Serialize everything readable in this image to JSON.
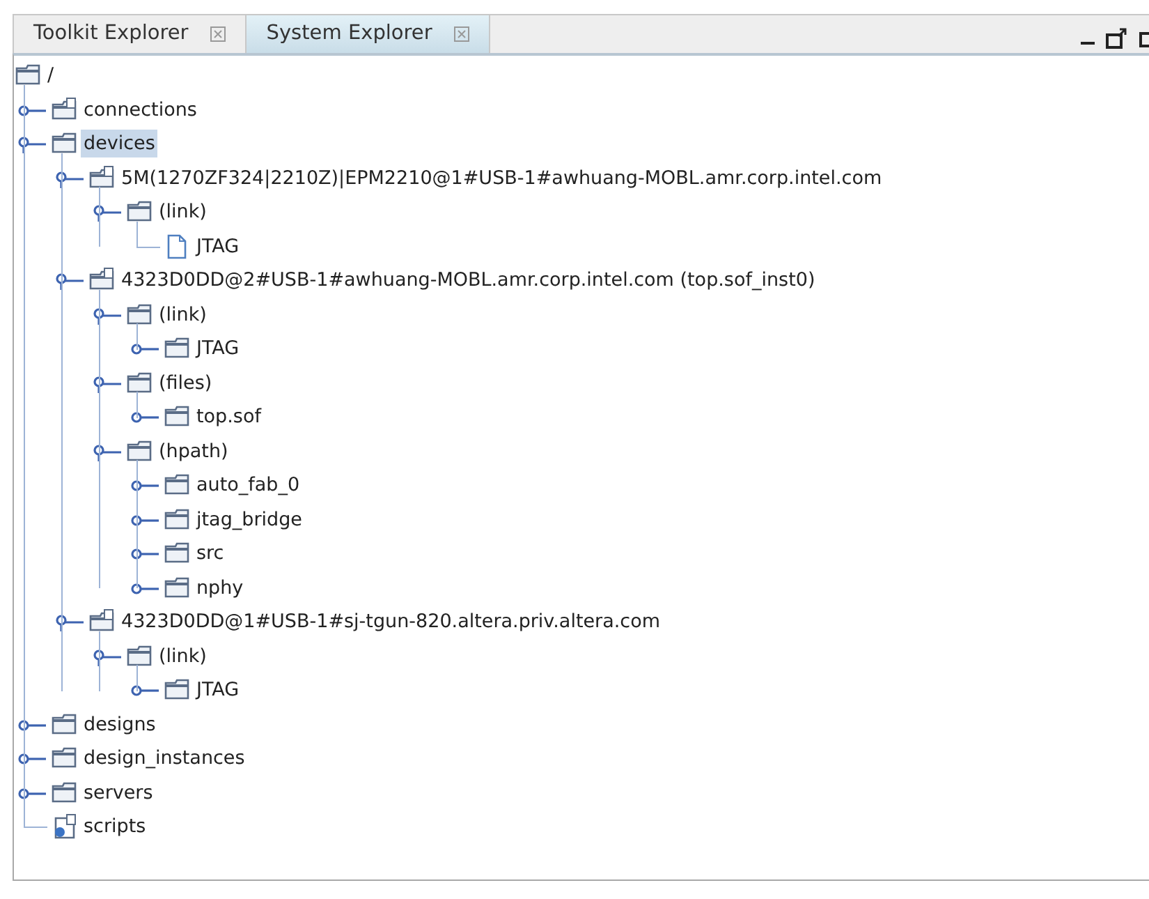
{
  "tabs": [
    {
      "label": "Toolkit Explorer",
      "selected": false
    },
    {
      "label": "System Explorer",
      "selected": true
    }
  ],
  "tree": {
    "label": "/",
    "kind": "folder",
    "selected": false,
    "children": [
      {
        "label": "connections",
        "kind": "badge-folder",
        "expanded": false,
        "selected": false
      },
      {
        "label": "devices",
        "kind": "folder",
        "expanded": true,
        "selected": true,
        "children": [
          {
            "label": "5M(1270ZF324|2210Z)|EPM2210@1#USB-1#awhuang-MOBL.amr.corp.intel.com",
            "kind": "badge-folder",
            "expanded": true,
            "selected": false,
            "children": [
              {
                "label": "(link)",
                "kind": "folder",
                "expanded": true,
                "selected": false,
                "children": [
                  {
                    "label": "JTAG",
                    "kind": "file",
                    "selected": false
                  }
                ]
              }
            ]
          },
          {
            "label": "4323D0DD@2#USB-1#awhuang-MOBL.amr.corp.intel.com (top.sof_inst0)",
            "kind": "badge-folder",
            "expanded": true,
            "selected": false,
            "children": [
              {
                "label": "(link)",
                "kind": "folder",
                "expanded": true,
                "selected": false,
                "children": [
                  {
                    "label": "JTAG",
                    "kind": "folder",
                    "expanded": false,
                    "selected": false
                  }
                ]
              },
              {
                "label": "(files)",
                "kind": "folder",
                "expanded": true,
                "selected": false,
                "children": [
                  {
                    "label": "top.sof",
                    "kind": "folder",
                    "expanded": false,
                    "selected": false
                  }
                ]
              },
              {
                "label": "(hpath)",
                "kind": "folder",
                "expanded": true,
                "selected": false,
                "children": [
                  {
                    "label": "auto_fab_0",
                    "kind": "folder",
                    "expanded": false,
                    "selected": false
                  },
                  {
                    "label": "jtag_bridge",
                    "kind": "folder",
                    "expanded": false,
                    "selected": false
                  },
                  {
                    "label": "src",
                    "kind": "folder",
                    "expanded": false,
                    "selected": false
                  },
                  {
                    "label": "nphy",
                    "kind": "folder",
                    "expanded": false,
                    "selected": false
                  }
                ]
              }
            ]
          },
          {
            "label": "4323D0DD@1#USB-1#sj-tgun-820.altera.priv.altera.com",
            "kind": "badge-folder",
            "expanded": true,
            "selected": false,
            "children": [
              {
                "label": "(link)",
                "kind": "folder",
                "expanded": true,
                "selected": false,
                "children": [
                  {
                    "label": "JTAG",
                    "kind": "folder",
                    "expanded": false,
                    "selected": false
                  }
                ]
              }
            ]
          }
        ]
      },
      {
        "label": "designs",
        "kind": "folder",
        "expanded": false,
        "selected": false
      },
      {
        "label": "design_instances",
        "kind": "folder",
        "expanded": false,
        "selected": false
      },
      {
        "label": "servers",
        "kind": "folder",
        "expanded": false,
        "selected": false
      },
      {
        "label": "scripts",
        "kind": "script",
        "selected": false
      }
    ]
  }
}
